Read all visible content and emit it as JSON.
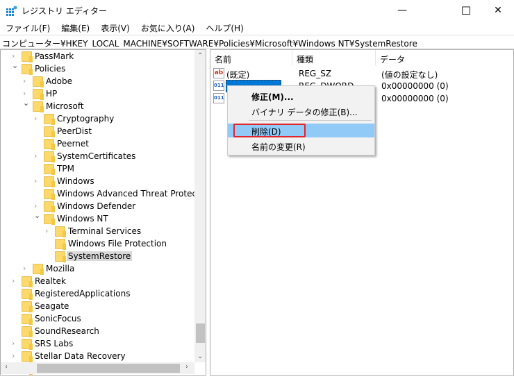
{
  "window": {
    "title": "レジストリ エディター",
    "minimize": "—",
    "maximize": "☐",
    "close": "✕"
  },
  "menu": [
    "ファイル(F)",
    "編集(E)",
    "表示(V)",
    "お気に入り(A)",
    "ヘルプ(H)"
  ],
  "address": "コンピューター¥HKEY_LOCAL_MACHINE¥SOFTWARE¥Policies¥Microsoft¥Windows NT¥SystemRestore",
  "tree": [
    {
      "label": "PassMark",
      "level": 0,
      "state": "collapsed"
    },
    {
      "label": "Policies",
      "level": 0,
      "state": "expanded"
    },
    {
      "label": "Adobe",
      "level": 1,
      "state": "collapsed"
    },
    {
      "label": "HP",
      "level": 1,
      "state": "collapsed"
    },
    {
      "label": "Microsoft",
      "level": 1,
      "state": "expanded"
    },
    {
      "label": "Cryptography",
      "level": 2,
      "state": "collapsed"
    },
    {
      "label": "PeerDist",
      "level": 2,
      "state": "leaf"
    },
    {
      "label": "Peernet",
      "level": 2,
      "state": "leaf"
    },
    {
      "label": "SystemCertificates",
      "level": 2,
      "state": "collapsed"
    },
    {
      "label": "TPM",
      "level": 2,
      "state": "leaf"
    },
    {
      "label": "Windows",
      "level": 2,
      "state": "collapsed"
    },
    {
      "label": "Windows Advanced Threat Protection",
      "level": 2,
      "state": "leaf"
    },
    {
      "label": "Windows Defender",
      "level": 2,
      "state": "collapsed"
    },
    {
      "label": "Windows NT",
      "level": 2,
      "state": "expanded"
    },
    {
      "label": "Terminal Services",
      "level": 3,
      "state": "collapsed"
    },
    {
      "label": "Windows File Protection",
      "level": 3,
      "state": "leaf"
    },
    {
      "label": "SystemRestore",
      "level": 3,
      "state": "leaf",
      "selected": true
    },
    {
      "label": "Mozilla",
      "level": 1,
      "state": "collapsed"
    },
    {
      "label": "Realtek",
      "level": 0,
      "state": "collapsed"
    },
    {
      "label": "RegisteredApplications",
      "level": 0,
      "state": "leaf"
    },
    {
      "label": "Seagate",
      "level": 0,
      "state": "leaf"
    },
    {
      "label": "SonicFocus",
      "level": 0,
      "state": "leaf"
    },
    {
      "label": "SoundResearch",
      "level": 0,
      "state": "leaf"
    },
    {
      "label": "SRS Labs",
      "level": 0,
      "state": "collapsed"
    },
    {
      "label": "Stellar Data Recovery",
      "level": 0,
      "state": "collapsed"
    },
    {
      "label": "",
      "level": 0,
      "state": "leaf"
    }
  ],
  "list": {
    "headers": {
      "name": "名前",
      "type": "種類",
      "data": "データ"
    },
    "rows": [
      {
        "icon": "string-value-icon",
        "name": "(既定)",
        "type": "REG_SZ",
        "data": "(値の設定なし)"
      },
      {
        "icon": "dword-value-icon",
        "name": "",
        "type": "REG_DWORD",
        "data": "0x00000000 (0)",
        "selected": true
      },
      {
        "icon": "dword-value-icon",
        "name": "",
        "type": "",
        "data": "0x00000000 (0)"
      }
    ]
  },
  "context_menu": {
    "modify": "修正(M)...",
    "modify_binary": "バイナリ データの修正(B)...",
    "delete": "削除(D)",
    "rename": "名前の変更(R)",
    "highlight_color": "#91c9f7",
    "annotation_color": "#e0262c"
  }
}
